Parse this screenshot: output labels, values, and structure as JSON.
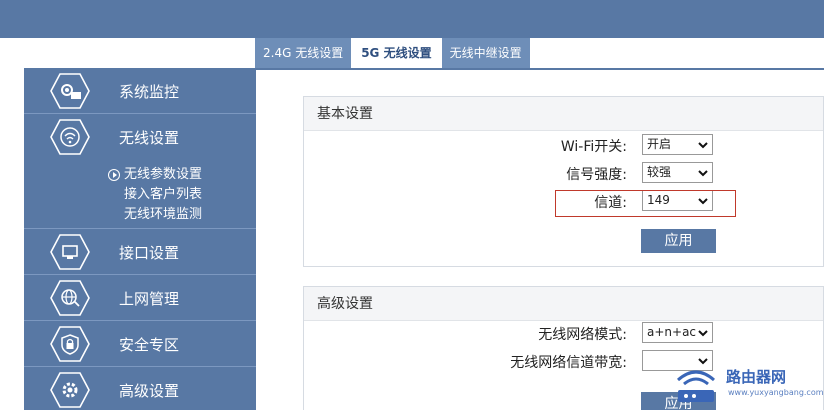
{
  "tabs": [
    {
      "label": "2.4G 无线设置",
      "active": false
    },
    {
      "label": "5G 无线设置",
      "active": true
    },
    {
      "label": "无线中继设置",
      "active": false
    }
  ],
  "sidebar": {
    "items": [
      {
        "label": "系统监控",
        "icon": "monitor-gear-icon"
      },
      {
        "label": "无线设置",
        "icon": "wifi-icon",
        "expanded": true,
        "subitems": [
          {
            "label": "无线参数设置",
            "selected": true
          },
          {
            "label": "接入客户列表",
            "selected": false
          },
          {
            "label": "无线环境监测",
            "selected": false
          }
        ]
      },
      {
        "label": "接口设置",
        "icon": "interface-icon"
      },
      {
        "label": "上网管理",
        "icon": "globe-icon"
      },
      {
        "label": "安全专区",
        "icon": "lock-shield-icon"
      },
      {
        "label": "高级设置",
        "icon": "gear-icon"
      }
    ]
  },
  "basic": {
    "title": "基本设置",
    "wifi_switch": {
      "label": "Wi-Fi开关:",
      "value": "开启"
    },
    "signal_strength": {
      "label": "信号强度:",
      "value": "较强"
    },
    "channel": {
      "label": "信道:",
      "value": "149"
    },
    "apply_label": "应用"
  },
  "advanced": {
    "title": "高级设置",
    "wireless_mode": {
      "label": "无线网络模式:",
      "value": "a+n+ac"
    },
    "channel_width": {
      "label": "无线网络信道带宽:"
    },
    "apply_label": "应用"
  },
  "watermark": {
    "title": "路由器网",
    "url": "www.yuxyangbang.com"
  },
  "colors": {
    "sidebar": "#5878a4",
    "accent": "#5878a4",
    "highlight_box": "#c0392b"
  }
}
